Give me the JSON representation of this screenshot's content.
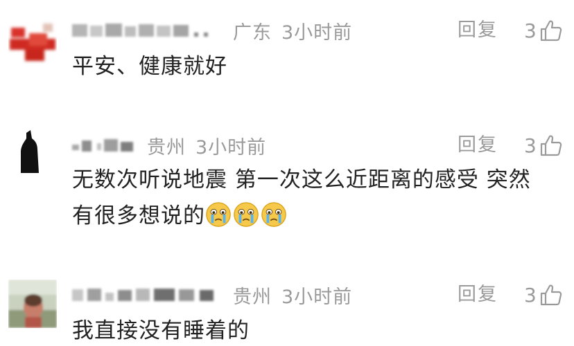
{
  "comments": [
    {
      "location": "广东",
      "time": "3小时前",
      "reply_label": "回复",
      "like_count": "3",
      "text": "平安、健康就好",
      "avatar_icon": "red-blurred-avatar",
      "like_icon": "thumbs-up-icon"
    },
    {
      "location": "贵州",
      "time": "3小时前",
      "reply_label": "回复",
      "like_count": "3",
      "text_line1": "无数次听说地震 第一次这么近距离的感受 突然",
      "text_line2": "有很多想说的",
      "emoji_icon": "crying-face-emoji",
      "avatar_icon": "dark-silhouette-avatar",
      "like_icon": "thumbs-up-icon"
    },
    {
      "location": "贵州",
      "time": "3小时前",
      "reply_label": "回复",
      "like_count": "3",
      "text": "我直接没有睡着的",
      "avatar_icon": "photo-avatar",
      "like_icon": "thumbs-up-icon"
    }
  ]
}
